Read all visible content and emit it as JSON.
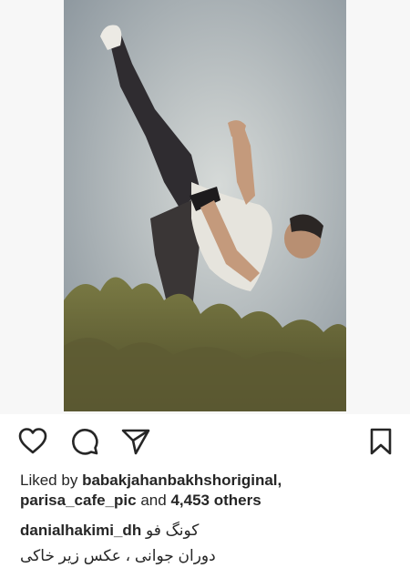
{
  "post": {
    "photo_alt": "",
    "actions": {
      "like_icon": "heart-outline-icon",
      "comment_icon": "speech-bubble-icon",
      "share_icon": "paper-plane-icon",
      "save_icon": "bookmark-outline-icon"
    },
    "likes": {
      "prefix": "Liked by",
      "user1": "babakjahanbakhshoriginal",
      "comma": ",",
      "user2": "parisa_cafe_pic",
      "connector": "and",
      "others": "4,453 others"
    },
    "caption": {
      "username": "danialhakimi_dh",
      "line1": "کونگ فو",
      "line2": "دوران جوانی ، عکس زیر خاکی"
    }
  },
  "colors": {
    "text": "#262626",
    "background": "#ffffff",
    "icon": "#262626"
  }
}
